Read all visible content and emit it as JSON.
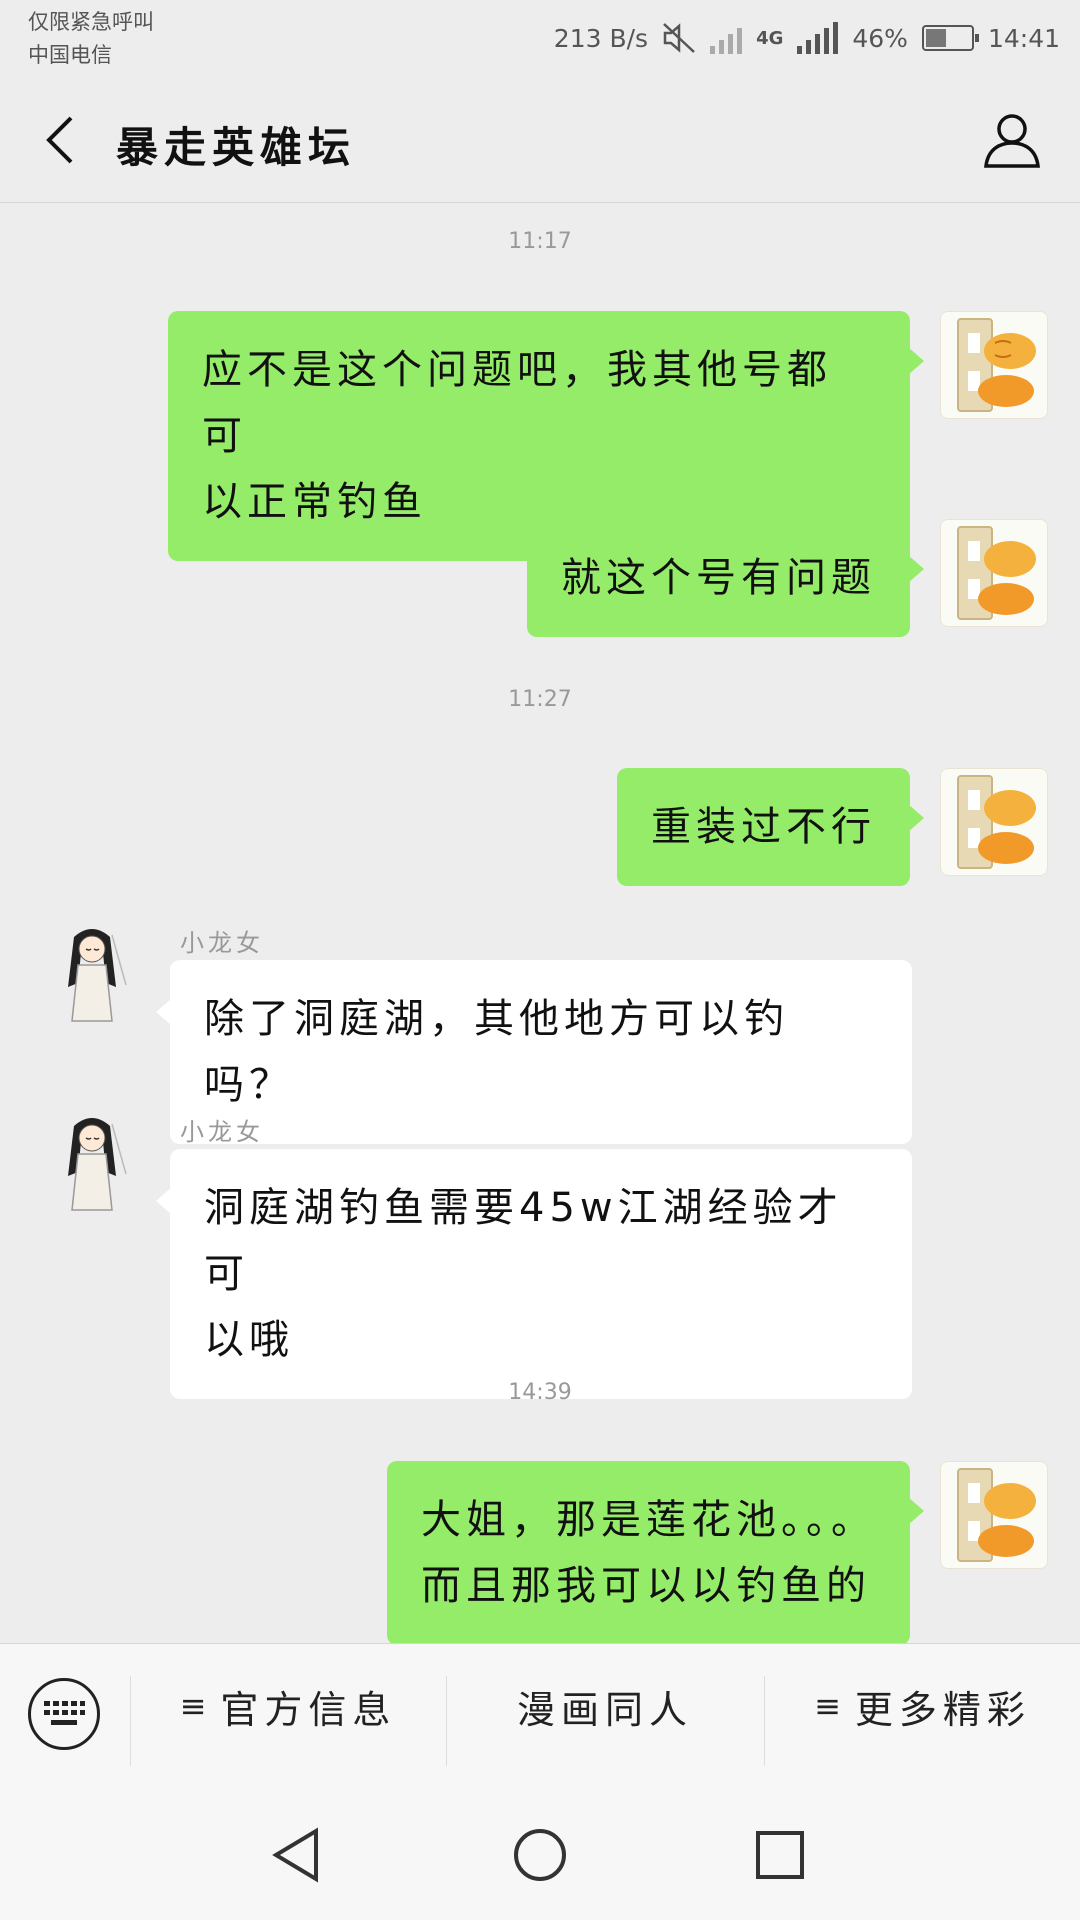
{
  "status_bar": {
    "line1": "仅限紧急呼叫",
    "line2": "中国电信",
    "net_speed": "213 B/s",
    "network": "4G",
    "battery": "46%",
    "battery_level": 0.46,
    "time": "14:41"
  },
  "header": {
    "title": "暴走英雄坛"
  },
  "chat": {
    "times": [
      "11:17",
      "11:27",
      "14:39"
    ],
    "messages": [
      {
        "from": "me",
        "lines": [
          "应不是这个问题吧，我其他号都可",
          "以正常钓鱼"
        ]
      },
      {
        "from": "me",
        "lines": [
          "就这个号有问题"
        ]
      },
      {
        "from": "me",
        "lines": [
          "重装过不行"
        ]
      },
      {
        "from": "other",
        "sender": "小龙女",
        "lines": [
          "除了洞庭湖，其他地方可以钓吗？"
        ]
      },
      {
        "from": "other",
        "sender": "小龙女",
        "lines": [
          "洞庭湖钓鱼需要45w江湖经验才可",
          "以哦"
        ]
      },
      {
        "from": "me",
        "lines": [
          "大姐，那是莲花池。。。",
          "而且那我可以以钓鱼的"
        ]
      }
    ]
  },
  "menu": {
    "items": [
      {
        "label": "官方信息",
        "has_list_icon": true
      },
      {
        "label": "漫画同人",
        "has_list_icon": false
      },
      {
        "label": "更多精彩",
        "has_list_icon": true
      }
    ],
    "list_glyph": "≡"
  },
  "colors": {
    "my_bubble": "#95ec69",
    "other_bubble": "#ffffff",
    "background": "#ededed"
  }
}
